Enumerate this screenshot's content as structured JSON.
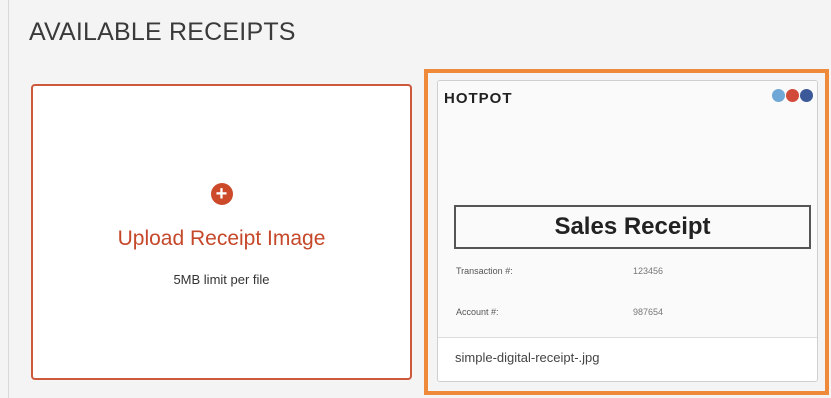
{
  "header": {
    "title": "AVAILABLE RECEIPTS"
  },
  "upload": {
    "label": "Upload Receipt Image",
    "limit": "5MB limit per file",
    "icon": "plus-circle-icon"
  },
  "receipt": {
    "thumbnail": {
      "store": "HOTPOT",
      "title": "Sales Receipt",
      "rows": [
        {
          "label": "Transaction #:",
          "value": "123456"
        },
        {
          "label": "Account #:",
          "value": "987654"
        }
      ],
      "social_icons": [
        "twitter-icon",
        "google-icon",
        "facebook-icon"
      ]
    },
    "filename": "simple-digital-receipt-.jpg"
  },
  "colors": {
    "accent": "#c6482a",
    "selected_outline": "#ee8a3a"
  }
}
